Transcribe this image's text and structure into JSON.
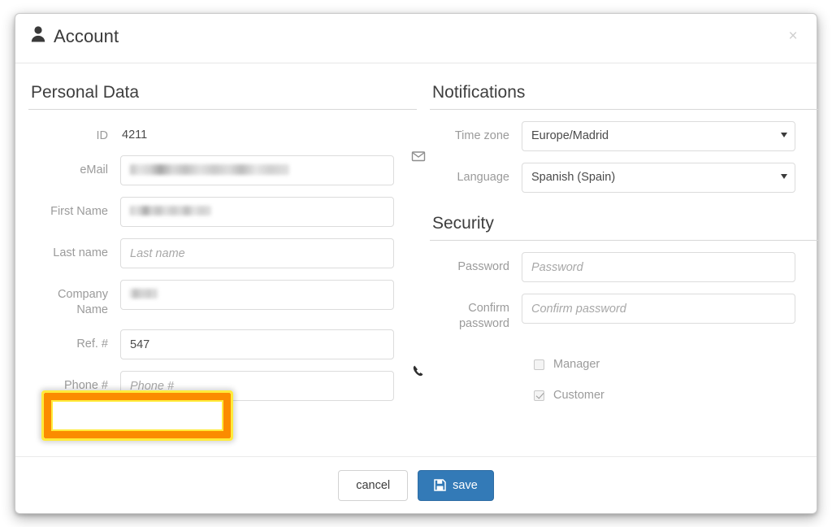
{
  "dialog": {
    "title": "Account",
    "title_icon": "person-icon",
    "close_icon": "×"
  },
  "personal": {
    "section_title": "Personal Data",
    "fields": {
      "id": {
        "label": "ID",
        "value": "4211"
      },
      "email": {
        "label": "eMail",
        "value": "",
        "redacted": true,
        "icon": "envelope-icon"
      },
      "first_name": {
        "label": "First Name",
        "value": "",
        "redacted": true
      },
      "last_name": {
        "label": "Last name",
        "placeholder": "Last name",
        "value": ""
      },
      "company_name": {
        "label_line1": "Company",
        "label_line2": "Name",
        "value": "",
        "redacted": true
      },
      "ref_no": {
        "label": "Ref. #",
        "value": "547"
      },
      "phone": {
        "label": "Phone #",
        "placeholder": "Phone #",
        "value": "",
        "icon": "phone-icon"
      }
    }
  },
  "notifications": {
    "section_title": "Notifications",
    "fields": {
      "time_zone": {
        "label": "Time zone",
        "value": "Europe/Madrid"
      },
      "language": {
        "label": "Language",
        "value": "Spanish (Spain)"
      }
    }
  },
  "security": {
    "section_title": "Security",
    "fields": {
      "password": {
        "label": "Password",
        "placeholder": "Password",
        "value": ""
      },
      "confirm_password": {
        "label_line1": "Confirm",
        "label_line2": "password",
        "placeholder": "Confirm password",
        "value": ""
      }
    },
    "roles": [
      {
        "label": "Manager",
        "checked": false
      },
      {
        "label": "Customer",
        "checked": true
      }
    ]
  },
  "footer": {
    "cancel_label": "cancel",
    "save_label": "save",
    "save_icon": "floppy-disk-icon"
  },
  "highlight": {
    "target": "ref-no-field",
    "border_color": "#fb8c00",
    "outline_color": "#ffeb3b"
  },
  "colors": {
    "primary": "#337ab7",
    "label_text": "#9b9b9b",
    "value_text": "#4a4a4a",
    "border": "#dcdcdc"
  }
}
